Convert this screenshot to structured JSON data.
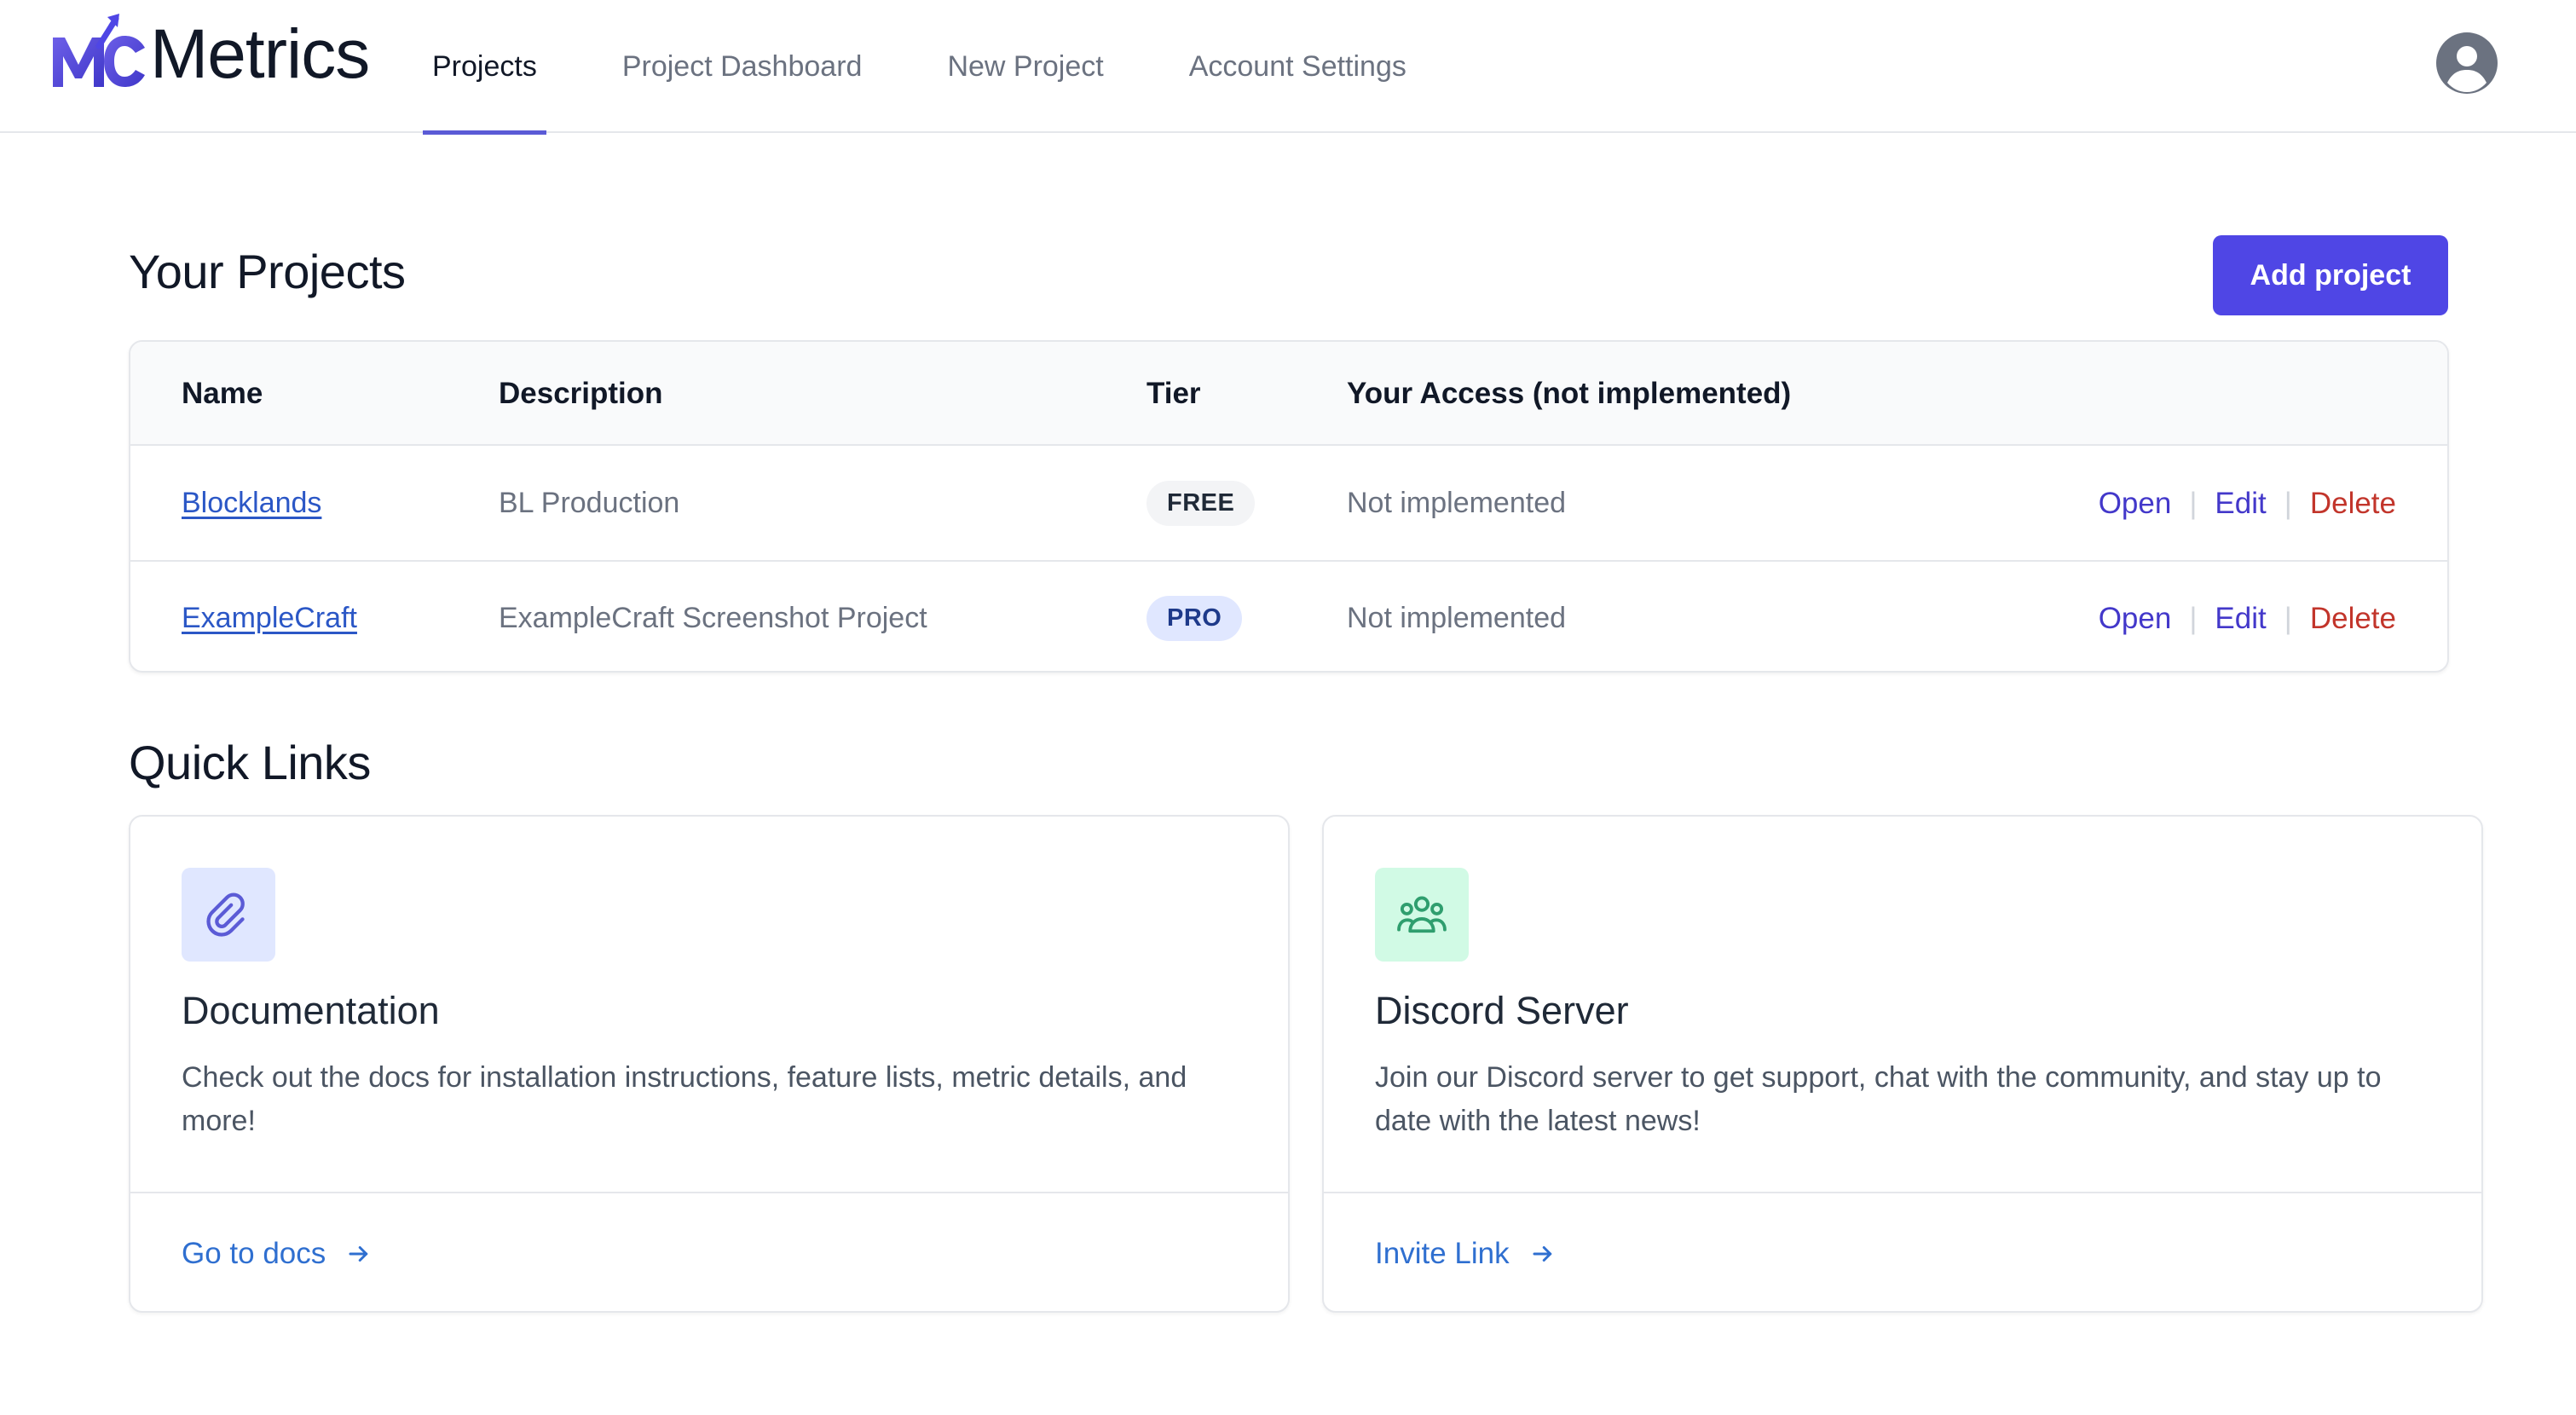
{
  "header": {
    "logo_text": "Metrics",
    "nav": [
      {
        "label": "Projects",
        "active": true
      },
      {
        "label": "Project Dashboard",
        "active": false
      },
      {
        "label": "New Project",
        "active": false
      },
      {
        "label": "Account Settings",
        "active": false
      }
    ],
    "avatar_icon": "user-circle-icon"
  },
  "projects": {
    "title": "Your Projects",
    "add_button_label": "Add project",
    "columns": [
      "Name",
      "Description",
      "Tier",
      "Your Access (not implemented)"
    ],
    "rows": [
      {
        "name": "Blocklands",
        "description": "BL Production",
        "tier": "FREE",
        "access": "Not implemented",
        "actions": {
          "open": "Open",
          "edit": "Edit",
          "delete": "Delete"
        }
      },
      {
        "name": "ExampleCraft",
        "description": "ExampleCraft Screenshot Project",
        "tier": "PRO",
        "access": "Not implemented",
        "actions": {
          "open": "Open",
          "edit": "Edit",
          "delete": "Delete"
        }
      }
    ]
  },
  "quick_links": {
    "title": "Quick Links",
    "cards": [
      {
        "icon": "paperclip-icon",
        "title": "Documentation",
        "description": "Check out the docs for installation instructions, feature lists, metric details, and more!",
        "link_label": "Go to docs"
      },
      {
        "icon": "users-group-icon",
        "title": "Discord Server",
        "description": "Join our Discord server to get support, chat with the community, and stay up to date with the latest news!",
        "link_label": "Invite Link"
      }
    ]
  },
  "colors": {
    "accent": "#4f46e5",
    "link": "#2b57c6",
    "delete": "#c2352b",
    "free_badge_bg": "#f3f4f6",
    "pro_badge_bg": "#e0e7ff"
  }
}
